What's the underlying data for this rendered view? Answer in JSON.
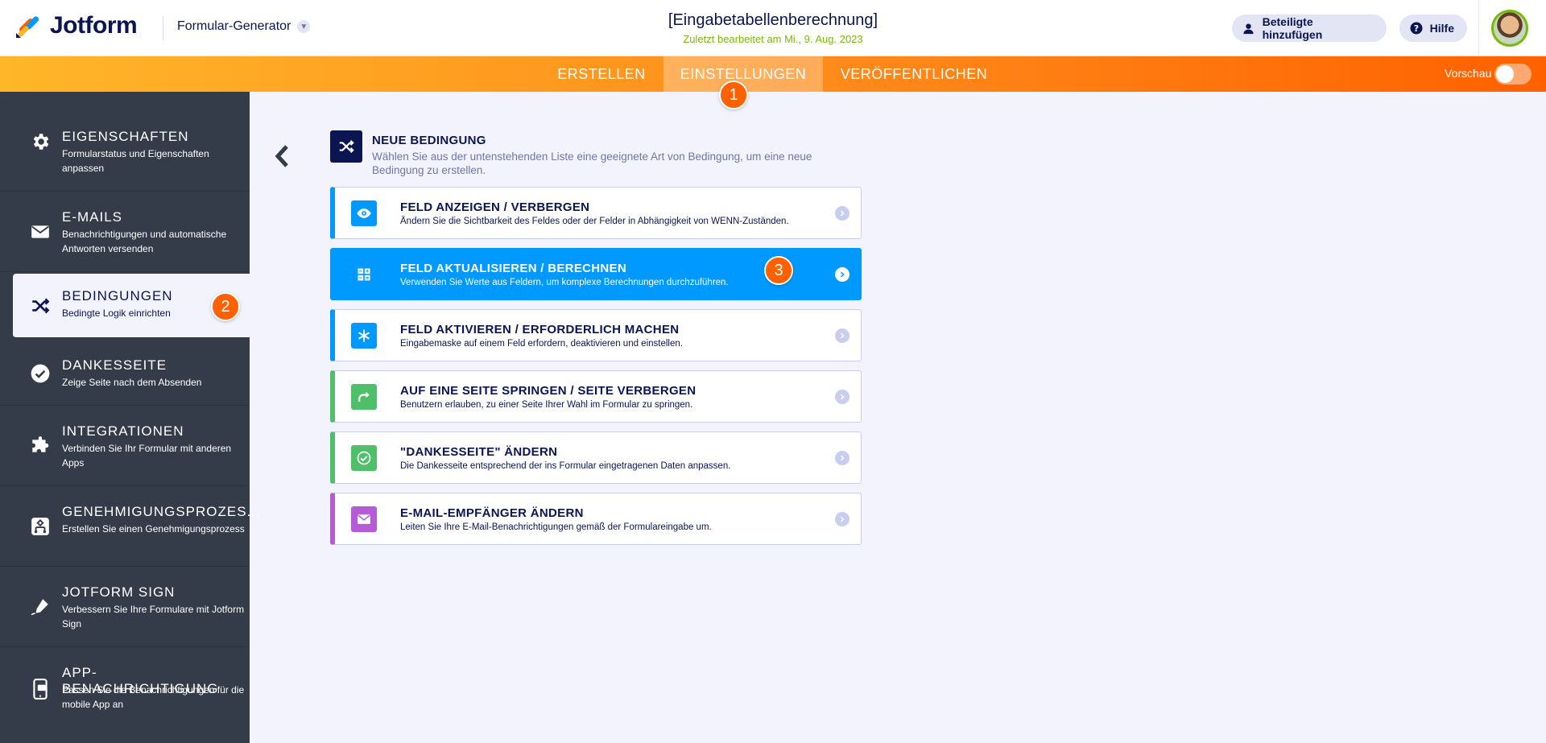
{
  "header": {
    "logo_text": "Jotform",
    "builder_label": "Formular-Generator",
    "form_title": "[Eingabetabellenberechnung]",
    "last_edited": "Zuletzt bearbeitet am Mi., 9. Aug. 2023",
    "invite_label": "Beteiligte hinzufügen",
    "help_label": "Hilfe"
  },
  "nav": {
    "tabs": [
      {
        "label": "ERSTELLEN"
      },
      {
        "label": "EINSTELLUNGEN"
      },
      {
        "label": "VERÖFFENTLICHEN"
      }
    ],
    "preview_label": "Vorschau"
  },
  "steps": [
    "1",
    "2",
    "3"
  ],
  "sidebar": {
    "items": [
      {
        "title": "EIGENSCHAFTEN",
        "desc": "Formularstatus und Eigenschaften anpassen",
        "icon": "gear-icon"
      },
      {
        "title": "E-MAILS",
        "desc": "Benachrichtigungen und automatische Antworten versenden",
        "icon": "envelope-icon"
      },
      {
        "title": "BEDINGUNGEN",
        "desc": "Bedingte Logik einrichten",
        "icon": "shuffle-icon"
      },
      {
        "title": "DANKESSEITE",
        "desc": "Zeige Seite nach dem Absenden",
        "icon": "check-circle-icon"
      },
      {
        "title": "INTEGRATIONEN",
        "desc": "Verbinden Sie Ihr Formular mit anderen Apps",
        "icon": "puzzle-icon"
      },
      {
        "title": "GENEHMIGUNGSPROZES...",
        "desc": "Erstellen Sie einen Genehmigungsprozess",
        "icon": "flow-icon"
      },
      {
        "title": "JOTFORM SIGN",
        "desc": "Verbessern Sie Ihre Formulare mit Jotform Sign",
        "icon": "pen-icon"
      },
      {
        "title": "APP-BENACHRICHTIGUNG",
        "desc": "Passen Sie die Benachrichtigungen für die mobile App an",
        "icon": "mobile-icon"
      }
    ]
  },
  "condition": {
    "title": "NEUE BEDINGUNG",
    "desc": "Wählen Sie aus der untenstehenden Liste eine geeignete Art von Bedingung, um eine neue Bedingung zu erstellen.",
    "options": [
      {
        "title": "FELD ANZEIGEN / VERBERGEN",
        "desc": "Ändern Sie die Sichtbarkeit des Feldes oder der Felder in Abhängigkeit von WENN-Zuständen.",
        "icon": "eye-icon",
        "color": "#0099ff"
      },
      {
        "title": "FELD AKTUALISIEREN / BERECHNEN",
        "desc": "Verwenden Sie Werte aus Feldern, um komplexe Berechnungen durchzuführen.",
        "icon": "calculator-icon",
        "color": "#0099ff"
      },
      {
        "title": "FELD AKTIVIEREN / ERFORDERLICH MACHEN",
        "desc": "Eingabemaske auf einem Feld erfordern, deaktivieren und einstellen.",
        "icon": "asterisk-icon",
        "color": "#0099ff"
      },
      {
        "title": "AUF EINE SEITE SPRINGEN / SEITE VERBERGEN",
        "desc": "Benutzern erlauben, zu einer Seite Ihrer Wahl im Formular zu springen.",
        "icon": "redirect-arrow-icon",
        "color": "#4fbf6a"
      },
      {
        "title": "\"DANKESSEITE\" ÄNDERN",
        "desc": "Die Dankesseite entsprechend der ins Formular eingetragenen Daten anpassen.",
        "icon": "check-icon",
        "color": "#4fbf6a"
      },
      {
        "title": "E-MAIL-EMPFÄNGER ÄNDERN",
        "desc": "Leiten Sie Ihre E-Mail-Benachrichtigungen gemäß der Formulareingabe um.",
        "icon": "envelope-icon",
        "color": "#b65bd6"
      }
    ]
  },
  "colors": {
    "brand_orange": "#ff6100",
    "navy": "#0a1551",
    "active_blue": "#0099ff",
    "green": "#4fbf6a",
    "purple": "#b65bd6",
    "edited_green": "#78bb07"
  }
}
